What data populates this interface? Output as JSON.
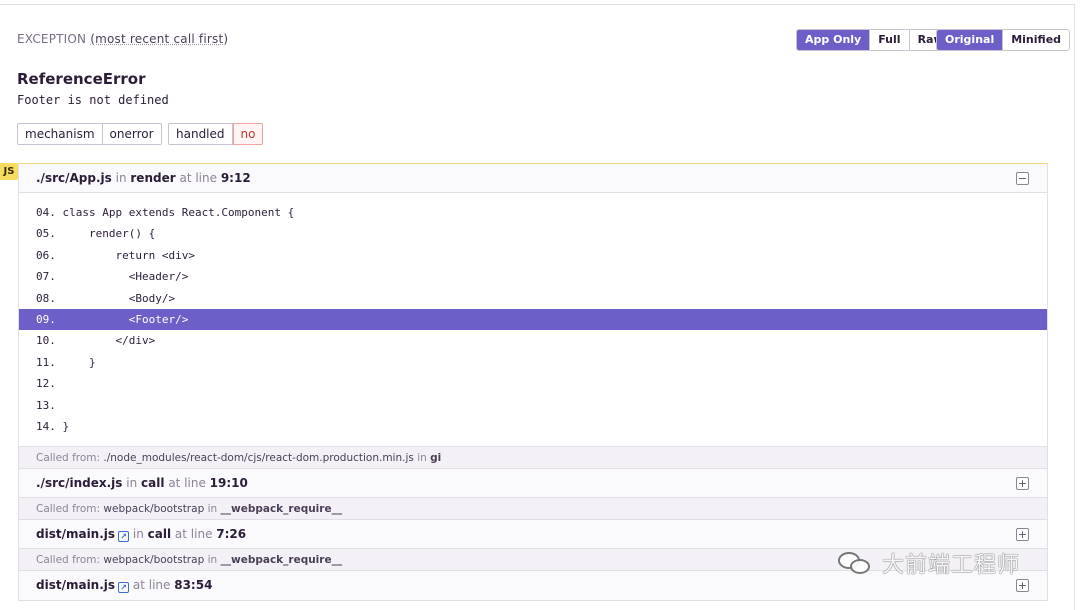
{
  "exception": {
    "title": "EXCEPTION",
    "subtitle": "(most recent call first)",
    "type": "ReferenceError",
    "message": "Footer is not defined"
  },
  "toolbar": {
    "app_only": "App Only",
    "full": "Full",
    "raw": "Raw",
    "original": "Original",
    "minified": "Minified"
  },
  "tags": {
    "mechanism_key": "mechanism",
    "mechanism_value": "onerror",
    "handled_key": "handled",
    "handled_value": "no"
  },
  "platform": "JS",
  "frame1": {
    "file": "./src/App.js",
    "in": "in",
    "function": "render",
    "at_line": "at line",
    "line": "9:12",
    "toggle": "−",
    "code": [
      {
        "text": "04. class App extends React.Component {",
        "active": false
      },
      {
        "text": "05.     render() {",
        "active": false
      },
      {
        "text": "06.         return <div>",
        "active": false
      },
      {
        "text": "07.           <Header/>",
        "active": false
      },
      {
        "text": "08.           <Body/>",
        "active": false
      },
      {
        "text": "09.           <Footer/>",
        "active": true
      },
      {
        "text": "10.         </div>",
        "active": false
      },
      {
        "text": "11.     }",
        "active": false
      },
      {
        "text": "12.",
        "active": false
      },
      {
        "text": "13.",
        "active": false
      },
      {
        "text": "14. }",
        "active": false
      }
    ]
  },
  "called1": {
    "prefix": "Called from:",
    "module": "./node_modules/react-dom/cjs/react-dom.production.min.js",
    "in": "in",
    "function": "gi"
  },
  "frame2": {
    "file": "./src/index.js",
    "in": "in",
    "function": "call",
    "at_line": "at line",
    "line": "19:10",
    "toggle": "+"
  },
  "called2": {
    "prefix": "Called from:",
    "module": "webpack/bootstrap",
    "in": "in",
    "function": "__webpack_require__"
  },
  "frame3": {
    "file": "dist/main.js",
    "in": "in",
    "function": "call",
    "at_line": "at line",
    "line": "7:26",
    "toggle": "+"
  },
  "called3": {
    "prefix": "Called from:",
    "module": "webpack/bootstrap",
    "in": "in",
    "function": "__webpack_require__"
  },
  "frame4": {
    "file": "dist/main.js",
    "at_line": "at line",
    "line": "83:54",
    "toggle": "+"
  },
  "watermark": "大前端工程师"
}
